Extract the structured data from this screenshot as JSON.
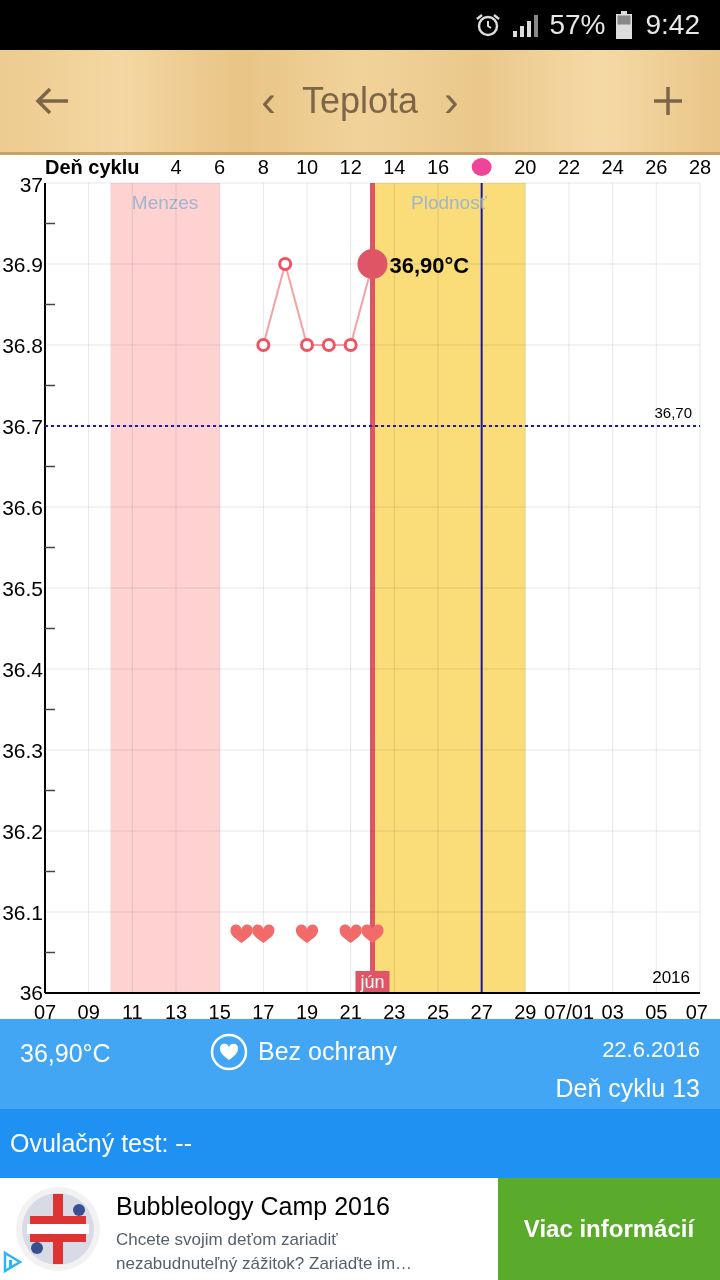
{
  "status_bar": {
    "battery": "57%",
    "time": "9:42"
  },
  "header": {
    "title": "Teplota",
    "prev": "‹",
    "next": "›"
  },
  "cycle_axis": {
    "label": "Deň cyklu",
    "ticks": [
      {
        "kind": "text",
        "text": "4"
      },
      {
        "kind": "text",
        "text": "6"
      },
      {
        "kind": "text",
        "text": "8"
      },
      {
        "kind": "text",
        "text": "10"
      },
      {
        "kind": "text",
        "text": "12"
      },
      {
        "kind": "text",
        "text": "14"
      },
      {
        "kind": "text",
        "text": "16"
      },
      {
        "kind": "dot",
        "color": "#f0449a"
      },
      {
        "kind": "text",
        "text": "20"
      },
      {
        "kind": "text",
        "text": "22"
      },
      {
        "kind": "text",
        "text": "24"
      },
      {
        "kind": "text",
        "text": "26"
      },
      {
        "kind": "text",
        "text": "28"
      }
    ]
  },
  "chart_data": {
    "type": "line",
    "grid": true,
    "marker": true,
    "categories": [
      "07",
      null,
      "09",
      null,
      "11",
      null,
      "13",
      null,
      "15",
      null,
      "17",
      null,
      "19",
      null,
      "21",
      null,
      "23",
      null,
      "25",
      null,
      "27",
      null,
      "29",
      null,
      "07/01",
      null,
      "03",
      null,
      "05",
      null,
      "07"
    ],
    "values": [
      null,
      null,
      null,
      null,
      null,
      null,
      null,
      null,
      null,
      null,
      36.8,
      36.9,
      36.8,
      36.8,
      36.8,
      36.9,
      null,
      null,
      null,
      null,
      null,
      null,
      null,
      null,
      null,
      null,
      null,
      null,
      null,
      null,
      null
    ],
    "ylim": [
      36,
      37
    ],
    "yticks": [
      36,
      36.1,
      36.2,
      36.3,
      36.4,
      36.5,
      36.6,
      36.7,
      36.8,
      36.9,
      37
    ],
    "ref_lines": [
      {
        "axis": "y",
        "value": 36.7,
        "label": "36,70",
        "color": "#1c1ca8"
      }
    ],
    "annotations": [
      "36,90°C",
      "2016"
    ]
  },
  "chart_overlays": {
    "bands": [
      {
        "label": "Menzes",
        "color": "#ffd2d2"
      },
      {
        "label": "Plodnosť",
        "color": "#fadc78"
      }
    ],
    "vertical_lines": [
      {
        "color": "#1c1ca8"
      },
      {
        "color": "#e05565",
        "label": "jún"
      }
    ]
  },
  "info": {
    "temperature": "36,90°C",
    "protection": "Bez ochrany",
    "date": "22.6.2016",
    "cycle_day": "Deň cyklu 13"
  },
  "ovulation_test": "Ovulačný test: --",
  "ad": {
    "title": "Bubbleology Camp 2016",
    "description": "Chcete svojim deťom zariadiť nezabudnuteľný zážitok? Zariaďte im…",
    "button": "Viac informácií"
  }
}
